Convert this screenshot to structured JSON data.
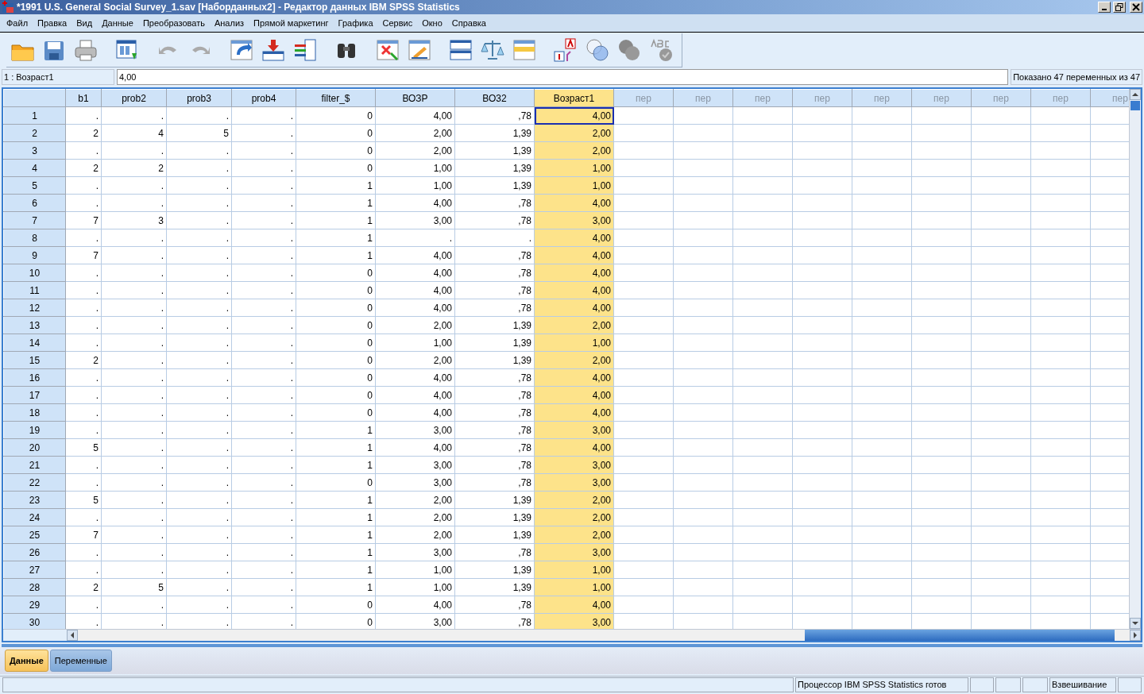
{
  "window": {
    "title": "*1991 U.S. General Social Survey_1.sav [Наборданных2] - Редактор данных IBM SPSS Statistics"
  },
  "menu": [
    {
      "label": "Файл"
    },
    {
      "label": "Правка"
    },
    {
      "label": "Вид"
    },
    {
      "label": "Данные"
    },
    {
      "label": "Преобразовать"
    },
    {
      "label": "Анализ"
    },
    {
      "label": "Прямой маркетинг"
    },
    {
      "label": "Графика"
    },
    {
      "label": "Сервис"
    },
    {
      "label": "Окно"
    },
    {
      "label": "Справка"
    }
  ],
  "cell_editor": {
    "cell_name": "1 : Возраст1",
    "value": "4,00",
    "visible_vars": "Показано 47 переменных из 47"
  },
  "table": {
    "columns": [
      {
        "label": "b1",
        "kind": "var",
        "selected": false
      },
      {
        "label": "prob2",
        "kind": "var",
        "selected": false
      },
      {
        "label": "prob3",
        "kind": "var",
        "selected": false
      },
      {
        "label": "prob4",
        "kind": "var",
        "selected": false
      },
      {
        "label": "filter_$",
        "kind": "var",
        "selected": false
      },
      {
        "label": "ВОЗР",
        "kind": "var",
        "selected": false
      },
      {
        "label": "ВО32",
        "kind": "var",
        "selected": false
      },
      {
        "label": "Возраст1",
        "kind": "var",
        "selected": true
      },
      {
        "label": "пер",
        "kind": "empty",
        "selected": false
      },
      {
        "label": "пер",
        "kind": "empty",
        "selected": false
      },
      {
        "label": "пер",
        "kind": "empty",
        "selected": false
      },
      {
        "label": "пер",
        "kind": "empty",
        "selected": false
      },
      {
        "label": "пер",
        "kind": "empty",
        "selected": false
      },
      {
        "label": "пер",
        "kind": "empty",
        "selected": false
      },
      {
        "label": "пер",
        "kind": "empty",
        "selected": false
      },
      {
        "label": "пер",
        "kind": "empty",
        "selected": false
      },
      {
        "label": "пер",
        "kind": "empty",
        "selected": false
      }
    ],
    "rows": [
      {
        "num": "1",
        "selected": true,
        "cells": [
          ".",
          ".",
          ".",
          ".",
          "0",
          "4,00",
          ",78",
          "4,00"
        ]
      },
      {
        "num": "2",
        "selected": false,
        "cells": [
          "2",
          "4",
          "5",
          ".",
          "0",
          "2,00",
          "1,39",
          "2,00"
        ]
      },
      {
        "num": "3",
        "selected": false,
        "cells": [
          ".",
          ".",
          ".",
          ".",
          "0",
          "2,00",
          "1,39",
          "2,00"
        ]
      },
      {
        "num": "4",
        "selected": false,
        "cells": [
          "2",
          "2",
          ".",
          ".",
          "0",
          "1,00",
          "1,39",
          "1,00"
        ]
      },
      {
        "num": "5",
        "selected": false,
        "cells": [
          ".",
          ".",
          ".",
          ".",
          "1",
          "1,00",
          "1,39",
          "1,00"
        ]
      },
      {
        "num": "6",
        "selected": false,
        "cells": [
          ".",
          ".",
          ".",
          ".",
          "1",
          "4,00",
          ",78",
          "4,00"
        ]
      },
      {
        "num": "7",
        "selected": false,
        "cells": [
          "7",
          "3",
          ".",
          ".",
          "1",
          "3,00",
          ",78",
          "3,00"
        ]
      },
      {
        "num": "8",
        "selected": false,
        "cells": [
          ".",
          ".",
          ".",
          ".",
          "1",
          ".",
          ".",
          "4,00"
        ]
      },
      {
        "num": "9",
        "selected": false,
        "cells": [
          "7",
          ".",
          ".",
          ".",
          "1",
          "4,00",
          ",78",
          "4,00"
        ]
      },
      {
        "num": "10",
        "selected": false,
        "cells": [
          ".",
          ".",
          ".",
          ".",
          "0",
          "4,00",
          ",78",
          "4,00"
        ]
      },
      {
        "num": "11",
        "selected": false,
        "cells": [
          ".",
          ".",
          ".",
          ".",
          "0",
          "4,00",
          ",78",
          "4,00"
        ]
      },
      {
        "num": "12",
        "selected": false,
        "cells": [
          ".",
          ".",
          ".",
          ".",
          "0",
          "4,00",
          ",78",
          "4,00"
        ]
      },
      {
        "num": "13",
        "selected": false,
        "cells": [
          ".",
          ".",
          ".",
          ".",
          "0",
          "2,00",
          "1,39",
          "2,00"
        ]
      },
      {
        "num": "14",
        "selected": false,
        "cells": [
          ".",
          ".",
          ".",
          ".",
          "0",
          "1,00",
          "1,39",
          "1,00"
        ]
      },
      {
        "num": "15",
        "selected": false,
        "cells": [
          "2",
          ".",
          ".",
          ".",
          "0",
          "2,00",
          "1,39",
          "2,00"
        ]
      },
      {
        "num": "16",
        "selected": false,
        "cells": [
          ".",
          ".",
          ".",
          ".",
          "0",
          "4,00",
          ",78",
          "4,00"
        ]
      },
      {
        "num": "17",
        "selected": false,
        "cells": [
          ".",
          ".",
          ".",
          ".",
          "0",
          "4,00",
          ",78",
          "4,00"
        ]
      },
      {
        "num": "18",
        "selected": false,
        "cells": [
          ".",
          ".",
          ".",
          ".",
          "0",
          "4,00",
          ",78",
          "4,00"
        ]
      },
      {
        "num": "19",
        "selected": false,
        "cells": [
          ".",
          ".",
          ".",
          ".",
          "1",
          "3,00",
          ",78",
          "3,00"
        ]
      },
      {
        "num": "20",
        "selected": false,
        "cells": [
          "5",
          ".",
          ".",
          ".",
          "1",
          "4,00",
          ",78",
          "4,00"
        ]
      },
      {
        "num": "21",
        "selected": false,
        "cells": [
          ".",
          ".",
          ".",
          ".",
          "1",
          "3,00",
          ",78",
          "3,00"
        ]
      },
      {
        "num": "22",
        "selected": false,
        "cells": [
          ".",
          ".",
          ".",
          ".",
          "0",
          "3,00",
          ",78",
          "3,00"
        ]
      },
      {
        "num": "23",
        "selected": false,
        "cells": [
          "5",
          ".",
          ".",
          ".",
          "1",
          "2,00",
          "1,39",
          "2,00"
        ]
      },
      {
        "num": "24",
        "selected": false,
        "cells": [
          ".",
          ".",
          ".",
          ".",
          "1",
          "2,00",
          "1,39",
          "2,00"
        ]
      },
      {
        "num": "25",
        "selected": false,
        "cells": [
          "7",
          ".",
          ".",
          ".",
          "1",
          "2,00",
          "1,39",
          "2,00"
        ]
      },
      {
        "num": "26",
        "selected": false,
        "cells": [
          ".",
          ".",
          ".",
          ".",
          "1",
          "3,00",
          ",78",
          "3,00"
        ]
      },
      {
        "num": "27",
        "selected": false,
        "cells": [
          ".",
          ".",
          ".",
          ".",
          "1",
          "1,00",
          "1,39",
          "1,00"
        ]
      },
      {
        "num": "28",
        "selected": false,
        "cells": [
          "2",
          "5",
          ".",
          ".",
          "1",
          "1,00",
          "1,39",
          "1,00"
        ]
      },
      {
        "num": "29",
        "selected": false,
        "cells": [
          ".",
          ".",
          ".",
          ".",
          "0",
          "4,00",
          ",78",
          "4,00"
        ]
      },
      {
        "num": "30",
        "selected": false,
        "cells": [
          ".",
          ".",
          ".",
          ".",
          "0",
          "3,00",
          ",78",
          "3,00"
        ]
      }
    ]
  },
  "tabs": [
    {
      "label": "Данные",
      "selected": true
    },
    {
      "label": "Переменные",
      "selected": false
    }
  ],
  "status_bar": [
    {
      "text": "Процессор IBM SPSS Statistics  готов"
    },
    {
      "text": "Взвешивание"
    }
  ]
}
